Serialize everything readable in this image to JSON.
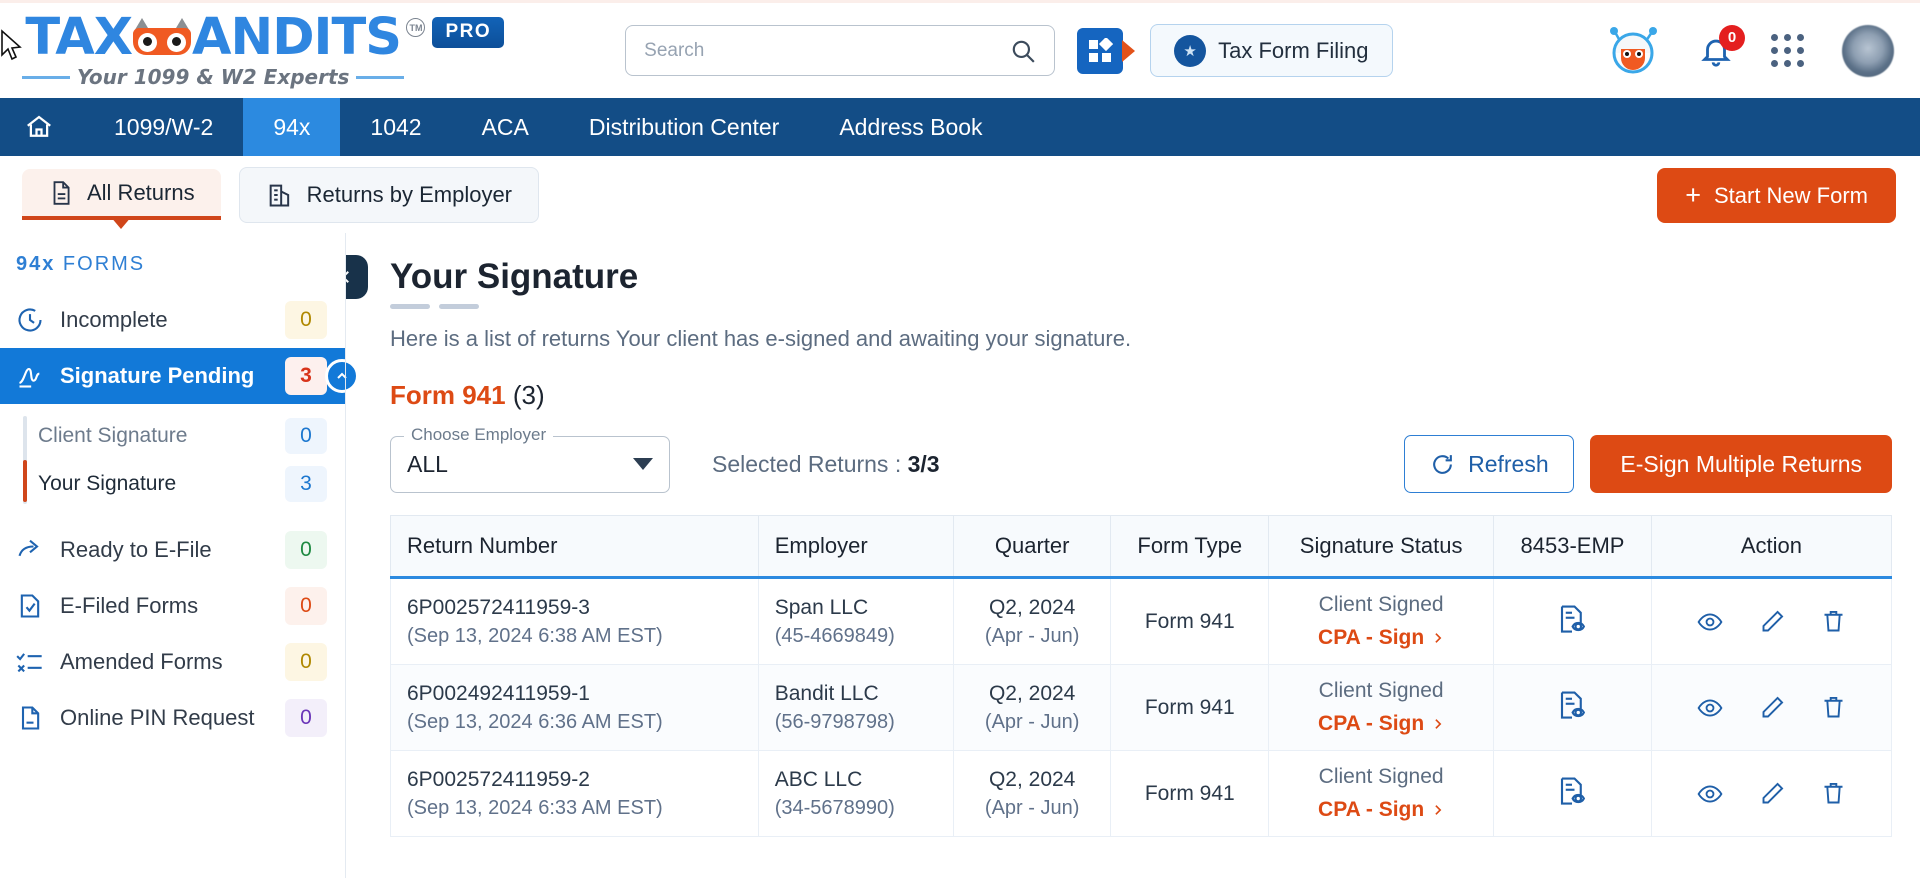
{
  "brand": {
    "name_part1": "TAX",
    "name_part2": "ANDITS",
    "tagline": "Your 1099 & W2 Experts",
    "tm": "TM",
    "pro": "PRO",
    "accent_orange": "#dd4a14",
    "accent_blue": "#2c8ae0",
    "nav_blue": "#134d86"
  },
  "header": {
    "search": {
      "placeholder": "Search",
      "value": "",
      "icon": "search-icon"
    },
    "apps_button_icon": "apps-grid-icon",
    "filing_button": {
      "label": "Tax Form Filing",
      "icon": "irs-seal-icon"
    },
    "assistant_icon": "owl-assistant-icon",
    "notifications": {
      "icon": "bell-icon",
      "count": "0"
    },
    "app_switcher_icon": "nine-dots-icon",
    "profile_icon": "user-avatar-icon"
  },
  "nav": {
    "home_icon": "home-icon",
    "items": [
      {
        "label": "1099/W-2",
        "active": false
      },
      {
        "label": "94x",
        "active": true
      },
      {
        "label": "1042",
        "active": false
      },
      {
        "label": "ACA",
        "active": false
      },
      {
        "label": "Distribution Center",
        "active": false
      },
      {
        "label": "Address Book",
        "active": false
      }
    ]
  },
  "tabs": {
    "all_returns": {
      "label": "All Returns",
      "icon": "document-icon"
    },
    "returns_by_employer": {
      "label": "Returns by Employer",
      "icon": "building-icon"
    },
    "start_new_form": {
      "label": "Start New Form",
      "icon": "plus-icon"
    }
  },
  "sidebar": {
    "title_bold": "94x",
    "title_rest": " FORMS",
    "items": [
      {
        "label": "Incomplete",
        "count": "0",
        "icon": "clock-icon",
        "tone": "yellow"
      },
      {
        "label": "Signature Pending",
        "count": "3",
        "icon": "signature-icon",
        "tone": "active"
      },
      {
        "label": "Ready to E-File",
        "count": "0",
        "icon": "share-arrow-icon",
        "tone": "green"
      },
      {
        "label": "E-Filed Forms",
        "count": "0",
        "icon": "file-check-icon",
        "tone": "orange"
      },
      {
        "label": "Amended Forms",
        "count": "0",
        "icon": "amend-list-icon",
        "tone": "yellow"
      },
      {
        "label": "Online PIN Request",
        "count": "0",
        "icon": "pin-file-icon",
        "tone": "purple"
      }
    ],
    "subitems": [
      {
        "label": "Client Signature",
        "count": "0",
        "selected": false
      },
      {
        "label": "Your Signature",
        "count": "3",
        "selected": true
      }
    ]
  },
  "main": {
    "collapse_icon": "chevron-left-icon",
    "page_title": "Your Signature",
    "description": "Here is a list of returns Your client has e-signed and awaiting your signature.",
    "form_heading_bold": "Form 941",
    "form_heading_count": "(3)",
    "employer_select": {
      "legend": "Choose Employer",
      "value": "ALL",
      "icon": "chevron-down-icon"
    },
    "selected_returns_label": "Selected Returns : ",
    "selected_returns_value": "3/3",
    "refresh_button": {
      "label": "Refresh",
      "icon": "refresh-icon"
    },
    "esign_button": {
      "label": "E-Sign Multiple Returns"
    }
  },
  "table": {
    "columns": [
      "Return Number",
      "Employer",
      "Quarter",
      "Form Type",
      "Signature Status",
      "8453-EMP",
      "Action"
    ],
    "rows": [
      {
        "return_number": "6P002572411959-3",
        "return_date": "(Sep 13, 2024 6:38 AM EST)",
        "employer_name": "Span LLC",
        "employer_ein": "(45-4669849)",
        "quarter": "Q2, 2024",
        "quarter_months": "(Apr - Jun)",
        "form_type": "Form 941",
        "signature_status": "Client Signed",
        "signature_link": "CPA - Sign",
        "emp8453_icon": "document-preview-icon",
        "actions": [
          "eye-icon",
          "pencil-icon",
          "trash-icon"
        ]
      },
      {
        "return_number": "6P002492411959-1",
        "return_date": "(Sep 13, 2024 6:36 AM EST)",
        "employer_name": "Bandit LLC",
        "employer_ein": "(56-9798798)",
        "quarter": "Q2, 2024",
        "quarter_months": "(Apr - Jun)",
        "form_type": "Form 941",
        "signature_status": "Client Signed",
        "signature_link": "CPA - Sign",
        "emp8453_icon": "document-preview-icon",
        "actions": [
          "eye-icon",
          "pencil-icon",
          "trash-icon"
        ]
      },
      {
        "return_number": "6P002572411959-2",
        "return_date": "(Sep 13, 2024 6:33 AM EST)",
        "employer_name": "ABC LLC",
        "employer_ein": "(34-5678990)",
        "quarter": "Q2, 2024",
        "quarter_months": "(Apr - Jun)",
        "form_type": "Form 941",
        "signature_status": "Client Signed",
        "signature_link": "CPA - Sign",
        "emp8453_icon": "document-preview-icon",
        "actions": [
          "eye-icon",
          "pencil-icon",
          "trash-icon"
        ]
      }
    ]
  }
}
